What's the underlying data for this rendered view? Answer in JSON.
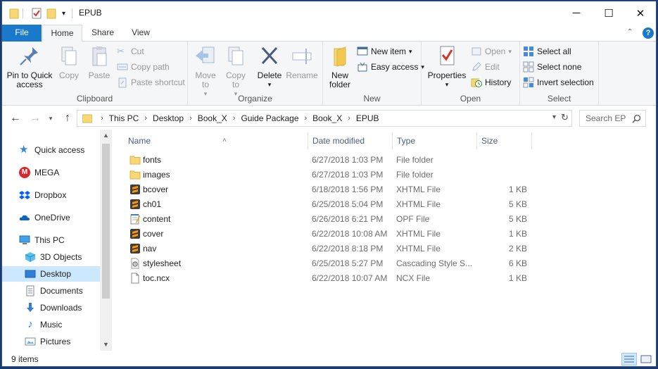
{
  "window": {
    "title": "EPUB",
    "controls": {
      "minimize": "─",
      "maximize": "☐",
      "close": "✕"
    }
  },
  "tabs": [
    {
      "label": "File"
    },
    {
      "label": "Home"
    },
    {
      "label": "Share"
    },
    {
      "label": "View"
    }
  ],
  "ribbon": {
    "clipboard": {
      "label": "Clipboard",
      "pin": "Pin to Quick access",
      "copy": "Copy",
      "paste": "Paste",
      "cut": "Cut",
      "copy_path": "Copy path",
      "paste_shortcut": "Paste shortcut"
    },
    "organize": {
      "label": "Organize",
      "move_to": "Move to",
      "copy_to": "Copy to",
      "delete": "Delete",
      "rename": "Rename"
    },
    "new": {
      "label": "New",
      "new_folder": "New folder",
      "new_item": "New item",
      "easy_access": "Easy access"
    },
    "open": {
      "label": "Open",
      "properties": "Properties",
      "open": "Open",
      "edit": "Edit",
      "history": "History"
    },
    "select": {
      "label": "Select",
      "select_all": "Select all",
      "select_none": "Select none",
      "invert_selection": "Invert selection"
    }
  },
  "address": {
    "breadcrumbs": [
      "This PC",
      "Desktop",
      "Book_X",
      "Guide Package",
      "Book_X",
      "EPUB"
    ],
    "search_placeholder": "Search EP"
  },
  "nav": {
    "items": [
      {
        "label": "Quick access"
      },
      {
        "label": "MEGA"
      },
      {
        "label": "Dropbox"
      },
      {
        "label": "OneDrive"
      },
      {
        "label": "This PC"
      },
      {
        "label": "3D Objects"
      },
      {
        "label": "Desktop"
      },
      {
        "label": "Documents"
      },
      {
        "label": "Downloads"
      },
      {
        "label": "Music"
      },
      {
        "label": "Pictures"
      }
    ]
  },
  "columns": {
    "name": "Name",
    "date": "Date modified",
    "type": "Type",
    "size": "Size"
  },
  "files": [
    {
      "name": "fonts",
      "date": "6/27/2018 1:03 PM",
      "type": "File folder",
      "size": "",
      "icon": "folder-icon"
    },
    {
      "name": "images",
      "date": "6/27/2018 1:03 PM",
      "type": "File folder",
      "size": "",
      "icon": "folder-icon"
    },
    {
      "name": "bcover",
      "date": "6/18/2018 1:56 PM",
      "type": "XHTML File",
      "size": "1 KB",
      "icon": "sublime-file-icon"
    },
    {
      "name": "ch01",
      "date": "6/25/2018 5:04 PM",
      "type": "XHTML File",
      "size": "5 KB",
      "icon": "sublime-file-icon"
    },
    {
      "name": "content",
      "date": "6/26/2018 6:21 PM",
      "type": "OPF File",
      "size": "5 KB",
      "icon": "notepad-file-icon"
    },
    {
      "name": "cover",
      "date": "6/22/2018 10:08 AM",
      "type": "XHTML File",
      "size": "1 KB",
      "icon": "sublime-file-icon"
    },
    {
      "name": "nav",
      "date": "6/22/2018 8:18 PM",
      "type": "XHTML File",
      "size": "2 KB",
      "icon": "sublime-file-icon"
    },
    {
      "name": "stylesheet",
      "date": "6/25/2018 5:27 PM",
      "type": "Cascading Style S...",
      "size": "6 KB",
      "icon": "css-file-icon"
    },
    {
      "name": "toc.ncx",
      "date": "6/22/2018 10:07 AM",
      "type": "NCX File",
      "size": "1 KB",
      "icon": "blank-file-icon"
    }
  ],
  "status": {
    "item_count": "9 items"
  },
  "colors": {
    "accent": "#1979ca",
    "selected": "#cce8ff",
    "folder": "#f8d775"
  }
}
